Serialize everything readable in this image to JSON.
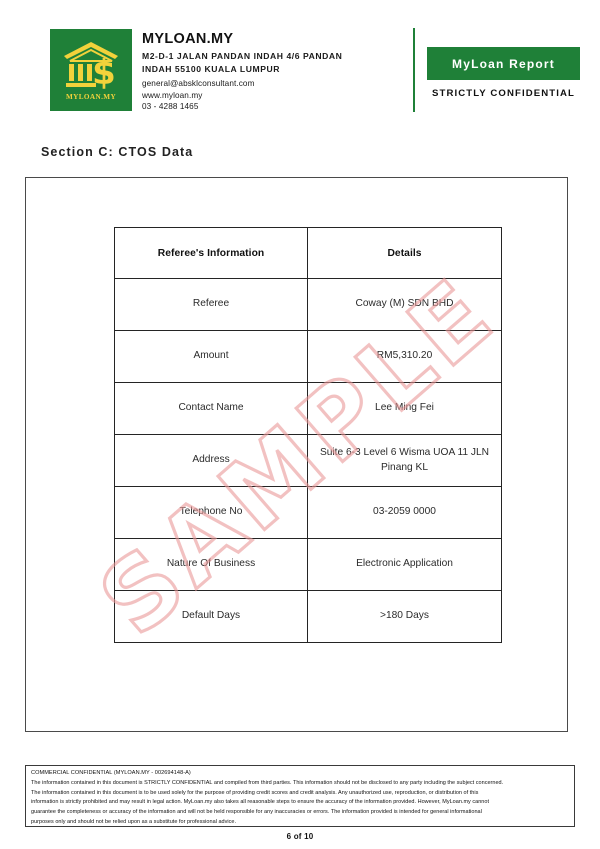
{
  "header": {
    "logo": {
      "icon": "bank-dollar-icon",
      "caption": "MYLOAN.MY",
      "background_color": "#1f8038",
      "mark_color": "#f2d23b"
    },
    "company_name": "MYLOAN.MY",
    "address_line1": "M2-D-1 JALAN PANDAN INDAH 4/6 PANDAN",
    "address_line2": "INDAH 55100 KUALA LUMPUR",
    "email": "general@absklconsultant.com",
    "website": "www.myloan.my",
    "phone": "03 - 4288 1465",
    "report_badge": "MyLoan Report",
    "confidential_tag": "STRICTLY CONFIDENTIAL",
    "accent_color": "#1f8038"
  },
  "section": {
    "title": "Section C: CTOS Data"
  },
  "watermark": {
    "text": "SAMPLE",
    "color": "#e89696"
  },
  "table": {
    "columns": [
      "Referee's Information",
      "Details"
    ],
    "rows": [
      {
        "label": "Referee",
        "value": "Coway (M) SDN BHD"
      },
      {
        "label": "Amount",
        "value": "RM5,310.20"
      },
      {
        "label": "Contact Name",
        "value": "Lee Ming Fei"
      },
      {
        "label": "Address",
        "value": "Suite 6-3 Level 6 Wisma UOA 11 JLN Pinang KL"
      },
      {
        "label": "Telephone No",
        "value": "03-2059 0000"
      },
      {
        "label": "Nature Of Business",
        "value": "Electronic Application"
      },
      {
        "label": "Default Days",
        "value": ">180 Days"
      }
    ]
  },
  "footer": {
    "title": "COMMERCIAL CONFIDENTIAL (MYLOAN.MY - 002694148-A)",
    "paragraph1": "The information contained in this document is STRICTLY CONFIDENTIAL and compiled from third parties. This information should not be disclosed to any party including the subject concerned.",
    "paragraph2": "The information contained in this document is to be used solely for the purpose of providing credit scores and credit analysis. Any unauthorized use, reproduction, or distribution of this",
    "paragraph3": "information is strictly prohibited and may result in legal action. MyLoan.my also takes all reasonable steps to ensure the accuracy of the information provided. However, MyLoan.my  cannot",
    "paragraph4": "guarantee the completeness or accuracy of the information and will not be held responsible for any inaccuracies or errors. The information provided is intended for general informational",
    "paragraph5": "purposes only and should not be relied upon as a substitute for professional advice.",
    "page_number": "6 of 10"
  }
}
